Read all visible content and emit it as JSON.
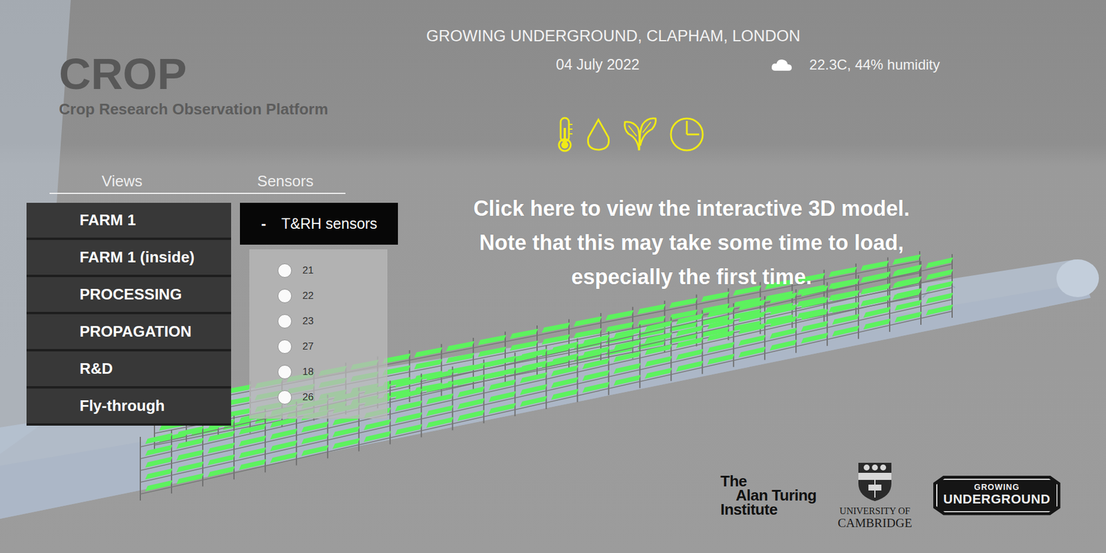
{
  "app": {
    "title": "CROP",
    "subtitle": "Crop Research Observation Platform"
  },
  "header": {
    "location": "GROWING UNDERGROUND, CLAPHAM, LONDON",
    "date": "04 July 2022",
    "weather": "22.3C, 44% humidity"
  },
  "views": {
    "heading": "Views",
    "items": [
      {
        "label": "FARM 1"
      },
      {
        "label": "FARM 1 (inside)"
      },
      {
        "label": "PROCESSING"
      },
      {
        "label": "PROPAGATION"
      },
      {
        "label": "R&D"
      },
      {
        "label": "Fly-through"
      }
    ]
  },
  "sensors": {
    "heading": "Sensors",
    "toggle": {
      "symbol": "-",
      "label": "T&RH sensors",
      "expanded": true
    },
    "items": [
      {
        "label": "21",
        "selected": false
      },
      {
        "label": "22",
        "selected": false
      },
      {
        "label": "23",
        "selected": false
      },
      {
        "label": "27",
        "selected": false
      },
      {
        "label": "18",
        "selected": false
      },
      {
        "label": "26",
        "selected": false
      }
    ]
  },
  "overlay": {
    "lines": [
      "Click here to view the interactive 3D model.",
      "Note that this may take some time to load,",
      "especially the first time."
    ]
  },
  "logos": {
    "turing": [
      "The",
      "Alan Turing",
      "Institute"
    ],
    "cambridge": [
      "UNIVERSITY OF",
      "CAMBRIDGE"
    ],
    "growing_underground": [
      "GROWING",
      "UNDERGROUND"
    ]
  }
}
